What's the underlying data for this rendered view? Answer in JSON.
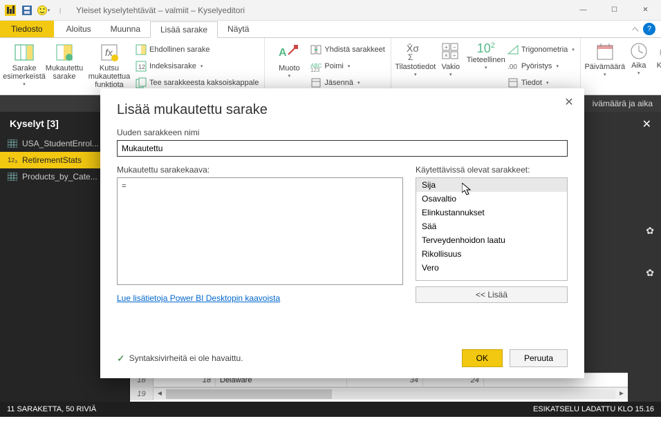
{
  "titlebar": {
    "title": "Yleiset kyselytehtävät – valmiit – Kyselyeditori",
    "qat_pbi_fill": "#f2c811",
    "qat_smile_fill": "#ffeb3b"
  },
  "tabs": {
    "file": "Tiedosto",
    "home": "Aloitus",
    "transform": "Muunna",
    "addcol": "Lisää sarake",
    "view": "Näytä"
  },
  "ribbon": {
    "sarake_esim": "Sarake esimerkeistä",
    "mukautettu": "Mukautettu sarake",
    "kutsu_fn": "Kutsu mukautettua funktiota",
    "ehdollinen": "Ehdollinen sarake",
    "indeksi": "Indeksisarake",
    "kaksois": "Tee sarakkeesta kaksoiskappale",
    "muoto": "Muoto",
    "yhdista": "Yhdistä sarakkeet",
    "poimi": "Poimi",
    "jasenna": "Jäsennä",
    "tilasto": "Tilastotiedot",
    "vakio": "Vakio",
    "tiet": "Tieteellinen",
    "ten2": "10",
    "ten2sup": "2",
    "trig": "Trigonometria",
    "pyor": "Pyöristys",
    "tiedot": "Tiedot",
    "pvm": "Päivämäärä",
    "aika": "Aika",
    "kesto": "Kesto"
  },
  "ctxbar": {
    "right": "ivämäärä ja aika"
  },
  "sidebar": {
    "header": "Kyselyt [3]",
    "items": [
      {
        "label": "USA_StudentEnrol..."
      },
      {
        "label": "RetirementStats"
      },
      {
        "label": "Products_by_Cate..."
      }
    ]
  },
  "grid": {
    "row18": {
      "n": "18",
      "c1": "18",
      "c2": "Delaware",
      "c3": "34",
      "c4": "24"
    },
    "row19": "19"
  },
  "dialog": {
    "title": "Lisää mukautettu sarake",
    "name_label": "Uuden sarakkeen nimi",
    "name_value": "Mukautettu",
    "formula_label": "Mukautettu sarakekaava:",
    "formula_value": "=",
    "avail_label": "Käytettävissä olevat sarakkeet:",
    "columns": [
      "Sija",
      "Osavaltio",
      "Elinkustannukset",
      "Sää",
      "Terveydenhoidon laatu",
      "Rikollisuus",
      "Vero"
    ],
    "insert": "<< Lisää",
    "link": "Lue lisätietoja Power BI Desktopin kaavoista",
    "syntax": "Syntaksivirheitä ei ole havaittu.",
    "ok": "OK",
    "cancel": "Peruuta"
  },
  "status": {
    "left": "11 SARAKETTA, 50 RIVIÄ",
    "right": "ESIKATSELU LADATTU KLO 15.16"
  }
}
